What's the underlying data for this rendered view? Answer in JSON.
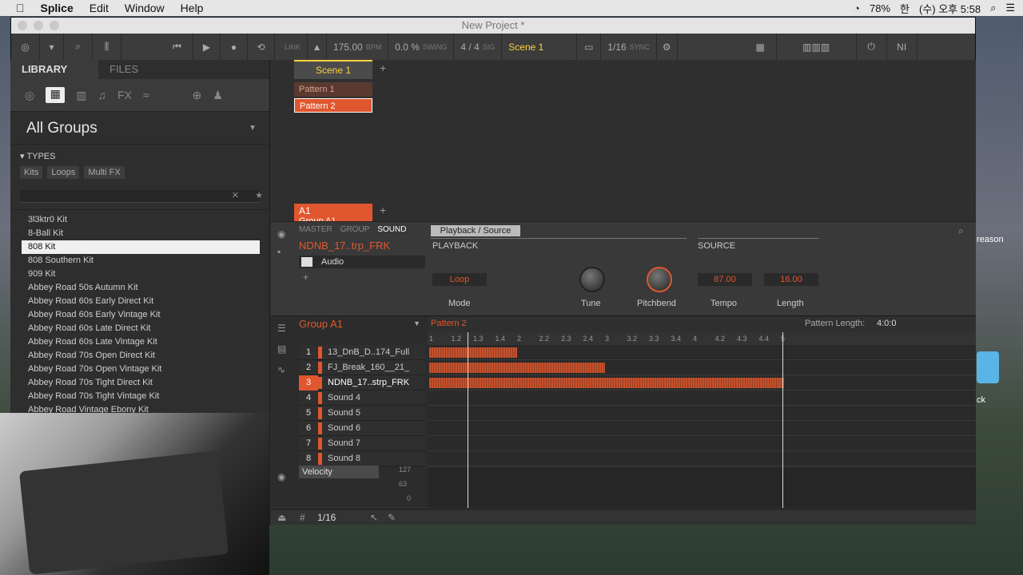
{
  "menubar": {
    "apple": "",
    "app": "Splice",
    "items": [
      "Edit",
      "Window",
      "Help"
    ],
    "battery": "78%",
    "input": "한",
    "clock": "(수) 오후 5:58"
  },
  "window": {
    "title": "New Project *"
  },
  "toolbar": {
    "link": "LINK",
    "bpm": "175.00",
    "bpm_unit": "BPM",
    "swing": "0.0 %",
    "swing_unit": "SWING",
    "sig": "4 / 4",
    "sig_unit": "SIG",
    "scene": "Scene 1",
    "quant": "1/16",
    "sync": "SYNC"
  },
  "library": {
    "tab_library": "LIBRARY",
    "tab_files": "FILES",
    "all_groups": "All Groups",
    "types_label": "TYPES",
    "type_tags": [
      "Kits",
      "Loops",
      "Multi FX"
    ],
    "kits": [
      "3l3ktr0 Kit",
      "8-Ball Kit",
      "808 Kit",
      "808 Southern Kit",
      "909 Kit",
      "Abbey Road 50s Autumn Kit",
      "Abbey Road 60s Early Direct Kit",
      "Abbey Road 60s Early Vintage Kit",
      "Abbey Road 60s Late Direct Kit",
      "Abbey Road 60s Late Vintage Kit",
      "Abbey Road 70s Open Direct Kit",
      "Abbey Road 70s Open Vintage Kit",
      "Abbey Road 70s Tight Direct Kit",
      "Abbey Road 70s Tight Vintage Kit",
      "Abbey Road Vintage Ebony Kit"
    ],
    "selected_index": 2
  },
  "arranger": {
    "scene": "Scene 1",
    "patterns": [
      "Pattern 1",
      "Pattern 2"
    ],
    "selected_pattern": 1,
    "group_slot": "A1",
    "group_name": "Group A1"
  },
  "sound": {
    "tabs": [
      "MASTER",
      "GROUP",
      "SOUND"
    ],
    "name": "NDNB_17..trp_FRK",
    "module": "Audio",
    "page": "Playback / Source",
    "playback": "PLAYBACK",
    "source": "SOURCE",
    "mode_value": "Loop",
    "mode_label": "Mode",
    "tune_label": "Tune",
    "pitch_label": "Pitchbend",
    "tempo_value": "87.00",
    "tempo_label": "Tempo",
    "length_value": "16.00",
    "length_label": "Length"
  },
  "pattern": {
    "group": "Group A1",
    "name": "Pattern 2",
    "length_label": "Pattern Length:",
    "length_value": "4:0:0",
    "ruler": [
      "1",
      "1.2",
      "1.3",
      "1.4",
      "2",
      "2.2",
      "2.3",
      "2.4",
      "3",
      "3.2",
      "3.3",
      "3.4",
      "4",
      "4.2",
      "4.3",
      "4.4",
      "5"
    ],
    "sounds": [
      "13_DnB_D..174_Full",
      "FJ_Break_160__21_",
      "NDNB_17..strp_FRK",
      "Sound 4",
      "Sound 5",
      "Sound 6",
      "Sound 7",
      "Sound 8"
    ],
    "selected_sound": 2,
    "velocity": "Velocity",
    "vel_ticks": [
      "127",
      "63",
      "0"
    ]
  },
  "footer": {
    "quant": "1/16"
  },
  "desktop": {
    "reason": "reason",
    "k": "ck"
  }
}
